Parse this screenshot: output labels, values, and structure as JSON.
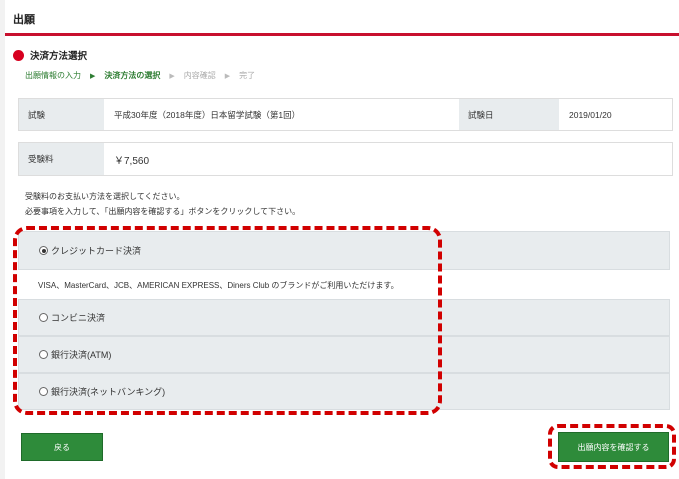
{
  "header": {
    "title": "出願"
  },
  "section": {
    "title": "決済方法選択"
  },
  "steps": [
    {
      "label": "出願情報の入力",
      "state": "done"
    },
    {
      "label": "決済方法の選択",
      "state": "active"
    },
    {
      "label": "内容確認",
      "state": "pending"
    },
    {
      "label": "完了",
      "state": "pending"
    }
  ],
  "exam": {
    "exam_label": "試験",
    "exam_value": "平成30年度（2018年度）日本留学試験（第1回）",
    "date_label": "試験日",
    "date_value": "2019/01/20",
    "fee_label": "受験料",
    "fee_value": "￥7,560"
  },
  "instructions": {
    "line1": "受験料のお支払い方法を選択してください。",
    "line2": "必要事項を入力して、「出願内容を確認する」ボタンをクリックして下さい。"
  },
  "payment": {
    "options": [
      {
        "label": "クレジットカード決済",
        "selected": true
      },
      {
        "label": "コンビニ決済",
        "selected": false
      },
      {
        "label": "銀行決済(ATM)",
        "selected": false
      },
      {
        "label": "銀行決済(ネットバンキング)",
        "selected": false
      }
    ],
    "card_brands": "VISA、MasterCard、JCB、AMERICAN EXPRESS、Diners Club のブランドがご利用いただけます。"
  },
  "buttons": {
    "back": "戻る",
    "confirm": "出願内容を確認する"
  },
  "colors": {
    "accent_red": "#c8102e",
    "button_green": "#2e8b3a",
    "step_green": "#2e7d32",
    "highlight_dash": "#d10000"
  }
}
